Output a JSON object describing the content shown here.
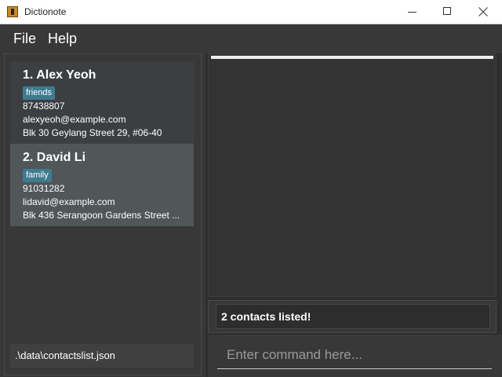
{
  "window": {
    "title": "Dictionote",
    "icon": "dictionary-book-icon"
  },
  "menu": {
    "items": [
      {
        "label": "File"
      },
      {
        "label": "Help"
      }
    ]
  },
  "contacts": [
    {
      "index_name": "1.  Alex Yeoh",
      "tag": "friends",
      "phone": "87438807",
      "email": "alexyeoh@example.com",
      "address": "Blk 30 Geylang Street 29, #06-40"
    },
    {
      "index_name": "2.  David Li",
      "tag": "family",
      "phone": "91031282",
      "email": "lidavid@example.com",
      "address": "Blk 436 Serangoon Gardens Street ..."
    }
  ],
  "status": {
    "file_path": ".\\data\\contactslist.json"
  },
  "result": {
    "message": "2 contacts listed!"
  },
  "command": {
    "value": "",
    "placeholder": "Enter command here..."
  },
  "colors": {
    "background": "#383838",
    "tag": "#3e7b91",
    "selected_card": "#515658"
  }
}
